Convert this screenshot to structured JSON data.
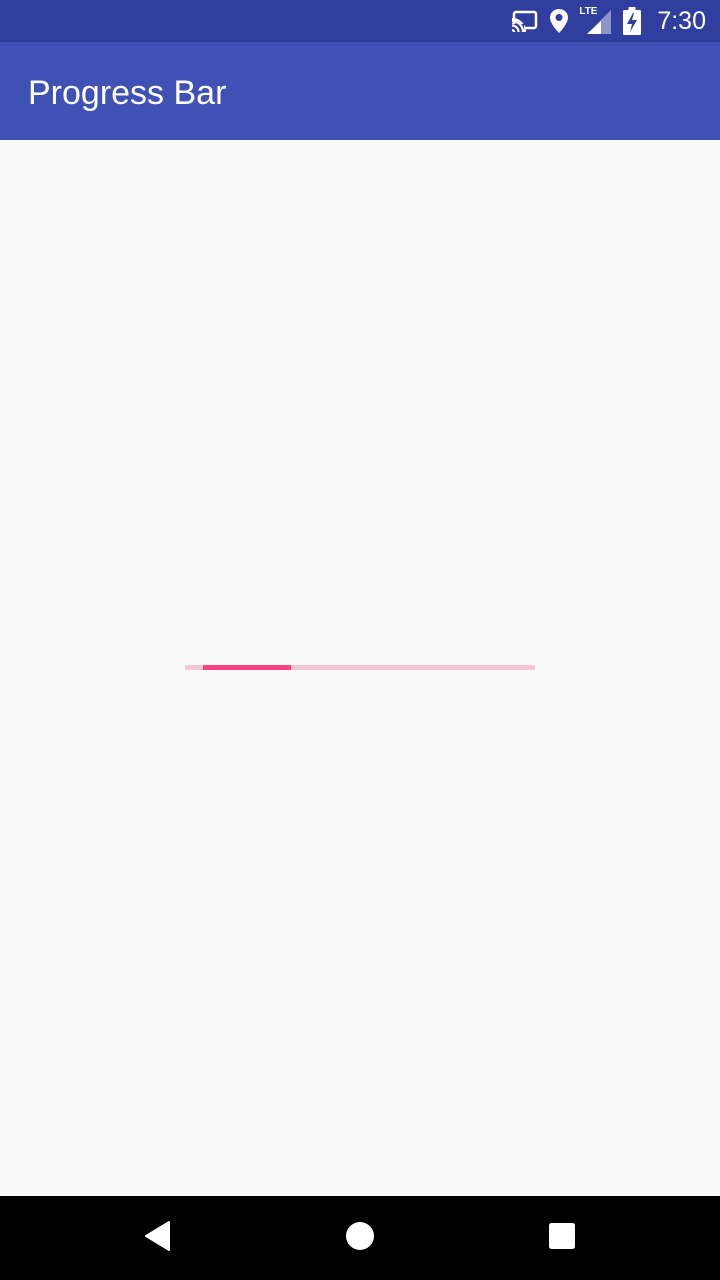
{
  "status_bar": {
    "time": "7:30",
    "network_label": "LTE",
    "icons": [
      "cast-icon",
      "location-icon",
      "signal-icon",
      "battery-charging-icon"
    ]
  },
  "app_bar": {
    "title": "Progress Bar",
    "color": "#3f51b5",
    "status_color": "#303f9f"
  },
  "progress": {
    "mode": "indeterminate",
    "segment_fraction": 0.25,
    "accent_color": "#ff4081",
    "track_color": "#f8c6d3"
  },
  "nav_bar": {
    "buttons": [
      "back-icon",
      "home-icon",
      "recents-icon"
    ]
  }
}
